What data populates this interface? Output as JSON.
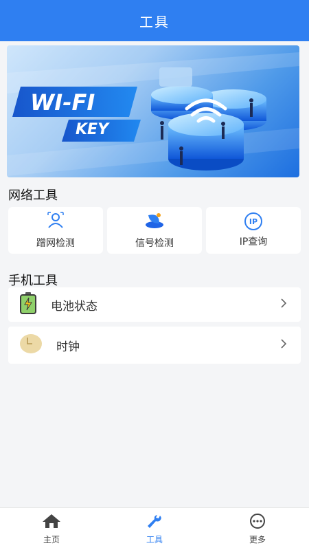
{
  "header": {
    "title": "工具"
  },
  "banner": {
    "line1": "WI-FI",
    "line2": "KEY"
  },
  "network_tools": {
    "title": "网络工具",
    "items": [
      {
        "label": "蹭网检测",
        "icon": "user-scan-icon"
      },
      {
        "label": "信号检测",
        "icon": "satellite-dish-icon"
      },
      {
        "label": "IP查询",
        "icon": "ip-icon",
        "icon_text": "IP"
      }
    ]
  },
  "phone_tools": {
    "title": "手机工具",
    "items": [
      {
        "label": "电池状态",
        "icon": "battery-icon"
      },
      {
        "label": "时钟",
        "icon": "clock-icon"
      }
    ]
  },
  "bottom_nav": {
    "items": [
      {
        "label": "主页",
        "icon": "home-icon"
      },
      {
        "label": "工具",
        "icon": "wrench-icon",
        "active": true
      },
      {
        "label": "更多",
        "icon": "more-icon"
      }
    ]
  },
  "colors": {
    "primary": "#2f7ff1",
    "background": "#f4f5f7"
  }
}
